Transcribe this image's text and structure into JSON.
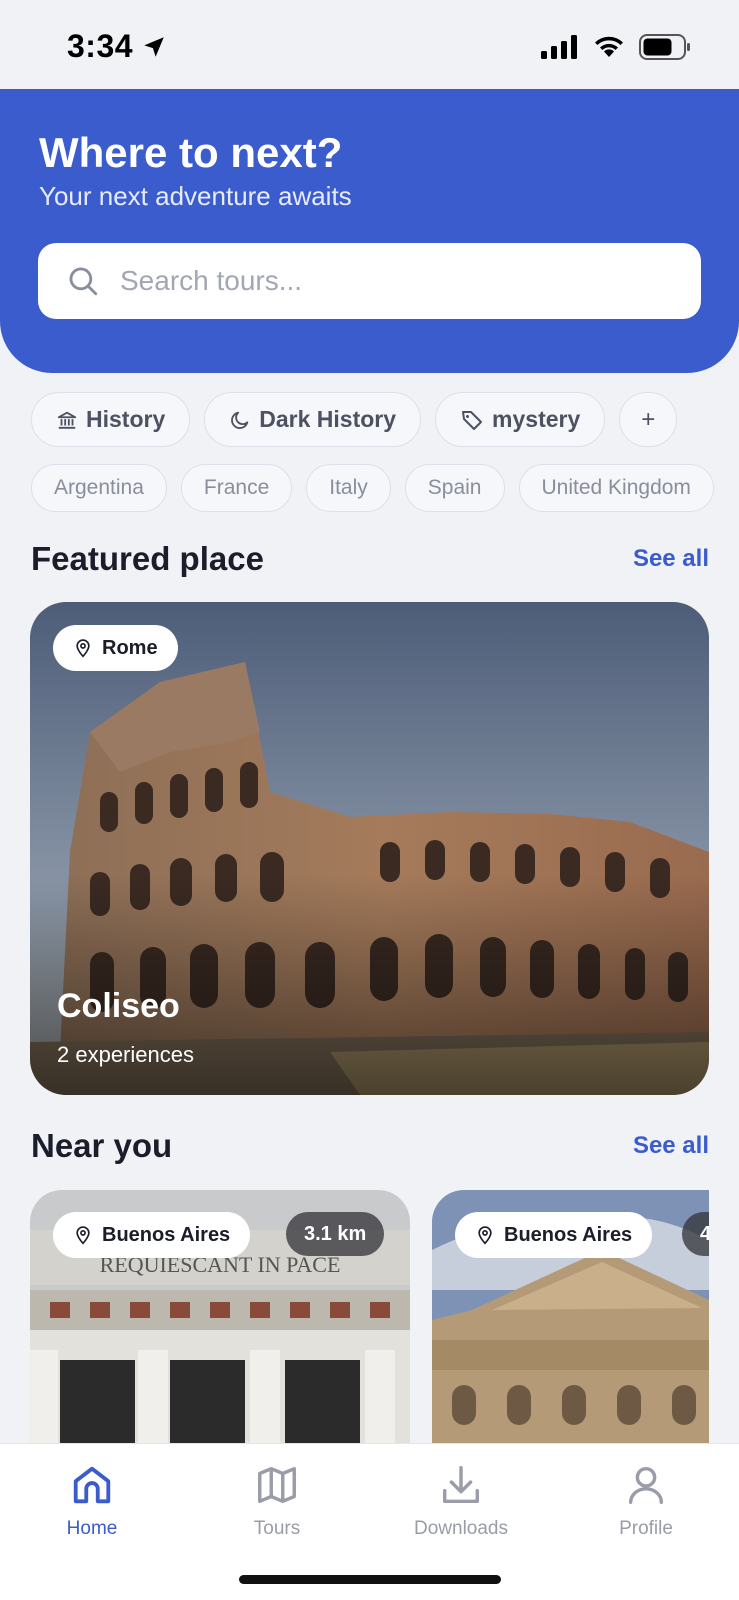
{
  "status_bar": {
    "time": "3:34"
  },
  "header": {
    "title": "Where to next?",
    "subtitle": "Your next adventure awaits",
    "search_placeholder": "Search tours..."
  },
  "tags": [
    {
      "label": "History",
      "icon": "museum-icon"
    },
    {
      "label": "Dark History",
      "icon": "moon-icon"
    },
    {
      "label": "mystery",
      "icon": "tag-icon"
    },
    {
      "label": "+",
      "icon": ""
    }
  ],
  "countries": [
    "Argentina",
    "France",
    "Italy",
    "Spain",
    "United Kingdom"
  ],
  "featured": {
    "section_title": "Featured place",
    "see_all": "See all",
    "location": "Rome",
    "name": "Coliseo",
    "experiences": "2 experiences"
  },
  "near_you": {
    "section_title": "Near you",
    "see_all": "See all",
    "cards": [
      {
        "location": "Buenos Aires",
        "distance": "3.1 km"
      },
      {
        "location": "Buenos Aires",
        "distance": "4"
      }
    ]
  },
  "nav": {
    "items": [
      {
        "label": "Home",
        "icon": "home-icon",
        "active": true
      },
      {
        "label": "Tours",
        "icon": "map-icon",
        "active": false
      },
      {
        "label": "Downloads",
        "icon": "download-icon",
        "active": false
      },
      {
        "label": "Profile",
        "icon": "user-icon",
        "active": false
      }
    ]
  },
  "colors": {
    "accent": "#3b5ccc",
    "background": "#f1f2f6"
  }
}
